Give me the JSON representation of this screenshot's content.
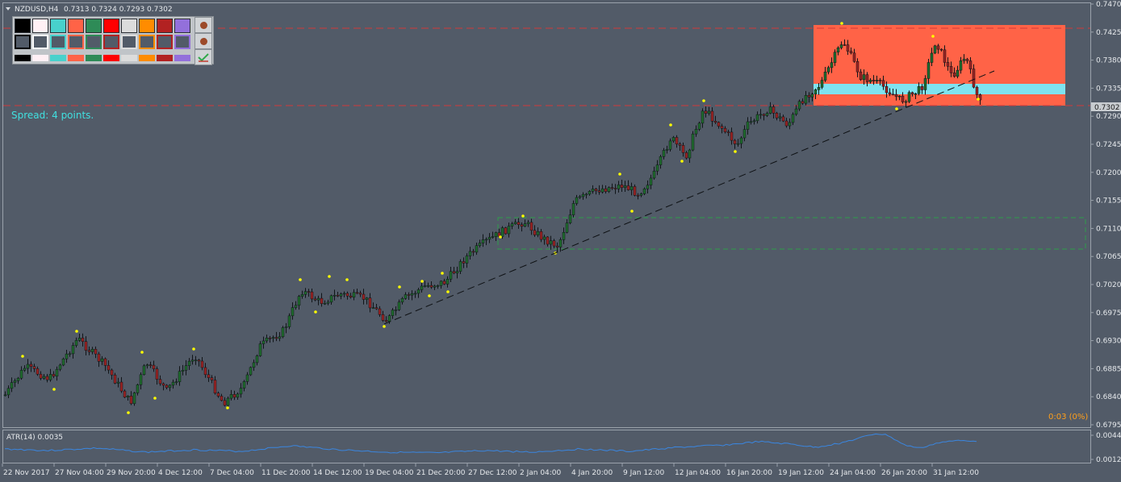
{
  "header": {
    "symbol": "NZDUSD,H4",
    "ohlc": "0.7313 0.7324 0.7293 0.7302",
    "menu_arrow_icon": "triangle-down-icon"
  },
  "spread_text": "Spread: 4 points.",
  "timer_text": "0:03 (0%)",
  "indicator": {
    "label": "ATR(14) 0.0035",
    "ticks": [
      "0.0044",
      "0.0012"
    ]
  },
  "price_axis": {
    "ticks": [
      "0.7470",
      "0.7425",
      "0.7380",
      "0.7335",
      "0.7290",
      "0.7245",
      "0.7200",
      "0.7155",
      "0.7110",
      "0.7065",
      "0.7020",
      "0.6975",
      "0.6930",
      "0.6885",
      "0.6840",
      "0.6795"
    ],
    "current_price": "0.7302"
  },
  "time_axis": {
    "labels": [
      "22 Nov 2017",
      "27 Nov 04:00",
      "29 Nov 20:00",
      "4 Dec 12:00",
      "7 Dec 04:00",
      "11 Dec 20:00",
      "14 Dec 12:00",
      "19 Dec 04:00",
      "21 Dec 20:00",
      "27 Dec 12:00",
      "2 Jan 04:00",
      "4 Jan 20:00",
      "9 Jan 12:00",
      "12 Jan 04:00",
      "16 Jan 20:00",
      "19 Jan 12:00",
      "24 Jan 04:00",
      "26 Jan 20:00",
      "31 Jan 12:00"
    ]
  },
  "palette": {
    "fill_colors": [
      "#000000",
      "#fff0f5",
      "#48d1cc",
      "#ff6347",
      "#2e8b57",
      "#ff0000",
      "#dcdcdc",
      "#ff8c00",
      "#b22222",
      "#9370db"
    ],
    "outline_colors": [
      "#000000",
      "#ffffff",
      "#48d1cc",
      "#ff6347",
      "#2e8b57",
      "#b22222",
      "#dcdcdc",
      "#ff8c00",
      "#b22222",
      "#9370db"
    ],
    "bar_colors": [
      "#000000",
      "#fff0f5",
      "#48d1cc",
      "#ff6347",
      "#2e8b57",
      "#ff0000",
      "#dcdcdc",
      "#ff8c00",
      "#b22222",
      "#9370db"
    ],
    "tool_icons": [
      "record-dot-icon",
      "record-dot-icon",
      "checkmark-arrow-icon"
    ]
  },
  "colors": {
    "background": "#525b68",
    "candle_bull": "#1f6b2e",
    "candle_bear": "#9b2323",
    "wick": "#101418",
    "zone_fill": "#ff6347",
    "zone_band": "#7fe3ef",
    "fractal": "#ffff00",
    "atr_line": "#3a86e0",
    "dashed_red": "#d23a3a",
    "spread_text": "#40e0e0",
    "timer_text": "#ff9f1a"
  }
}
